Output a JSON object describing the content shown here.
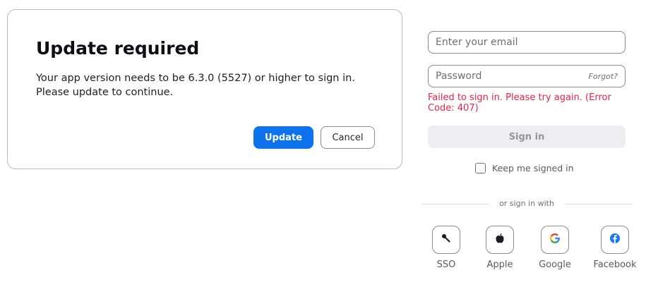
{
  "dialog": {
    "title": "Update required",
    "message_line1": "Your app version needs to be 6.3.0 (5527) or higher to sign in.",
    "message_line2": "Please update to continue.",
    "update_label": "Update",
    "cancel_label": "Cancel"
  },
  "signin": {
    "email_placeholder": "Enter your email",
    "password_placeholder": "Password",
    "forgot_label": "Forgot?",
    "error_message": "Failed to sign in. Please try again. (Error Code: 407)",
    "signin_label": "Sign in",
    "keep_signed_in_label": "Keep me signed in",
    "keep_signed_in_checked": false,
    "divider_text": "or sign in with",
    "providers": [
      {
        "label": "SSO",
        "icon": "key-icon"
      },
      {
        "label": "Apple",
        "icon": "apple-icon"
      },
      {
        "label": "Google",
        "icon": "google-icon"
      },
      {
        "label": "Facebook",
        "icon": "facebook-icon"
      }
    ]
  },
  "colors": {
    "primary": "#0e72ed",
    "error": "#e0244a",
    "disabled_bg": "#ededf2",
    "facebook": "#1877f2"
  }
}
